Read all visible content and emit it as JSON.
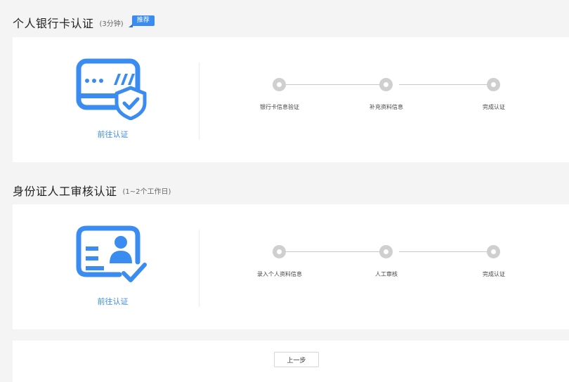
{
  "section1": {
    "title": "个人银行卡认证",
    "subtitle": "(3分钟)",
    "badge": "推荐",
    "go_link": "前往认证",
    "steps": [
      "银行卡信息验证",
      "补充资料信息",
      "完成认证"
    ]
  },
  "section2": {
    "title": "身份证人工审核认证",
    "subtitle": "(1~2个工作日)",
    "go_link": "前往认证",
    "steps": [
      "录入个人资料信息",
      "人工审核",
      "完成认证"
    ]
  },
  "footer": {
    "prev_label": "上一步"
  },
  "colors": {
    "accent": "#3b8cf0",
    "step_dot": "#cfcfcf",
    "page_bg": "#f4f4f4"
  },
  "icons": {
    "section1": "bank-card-shield-icon",
    "section2": "id-card-check-icon"
  }
}
